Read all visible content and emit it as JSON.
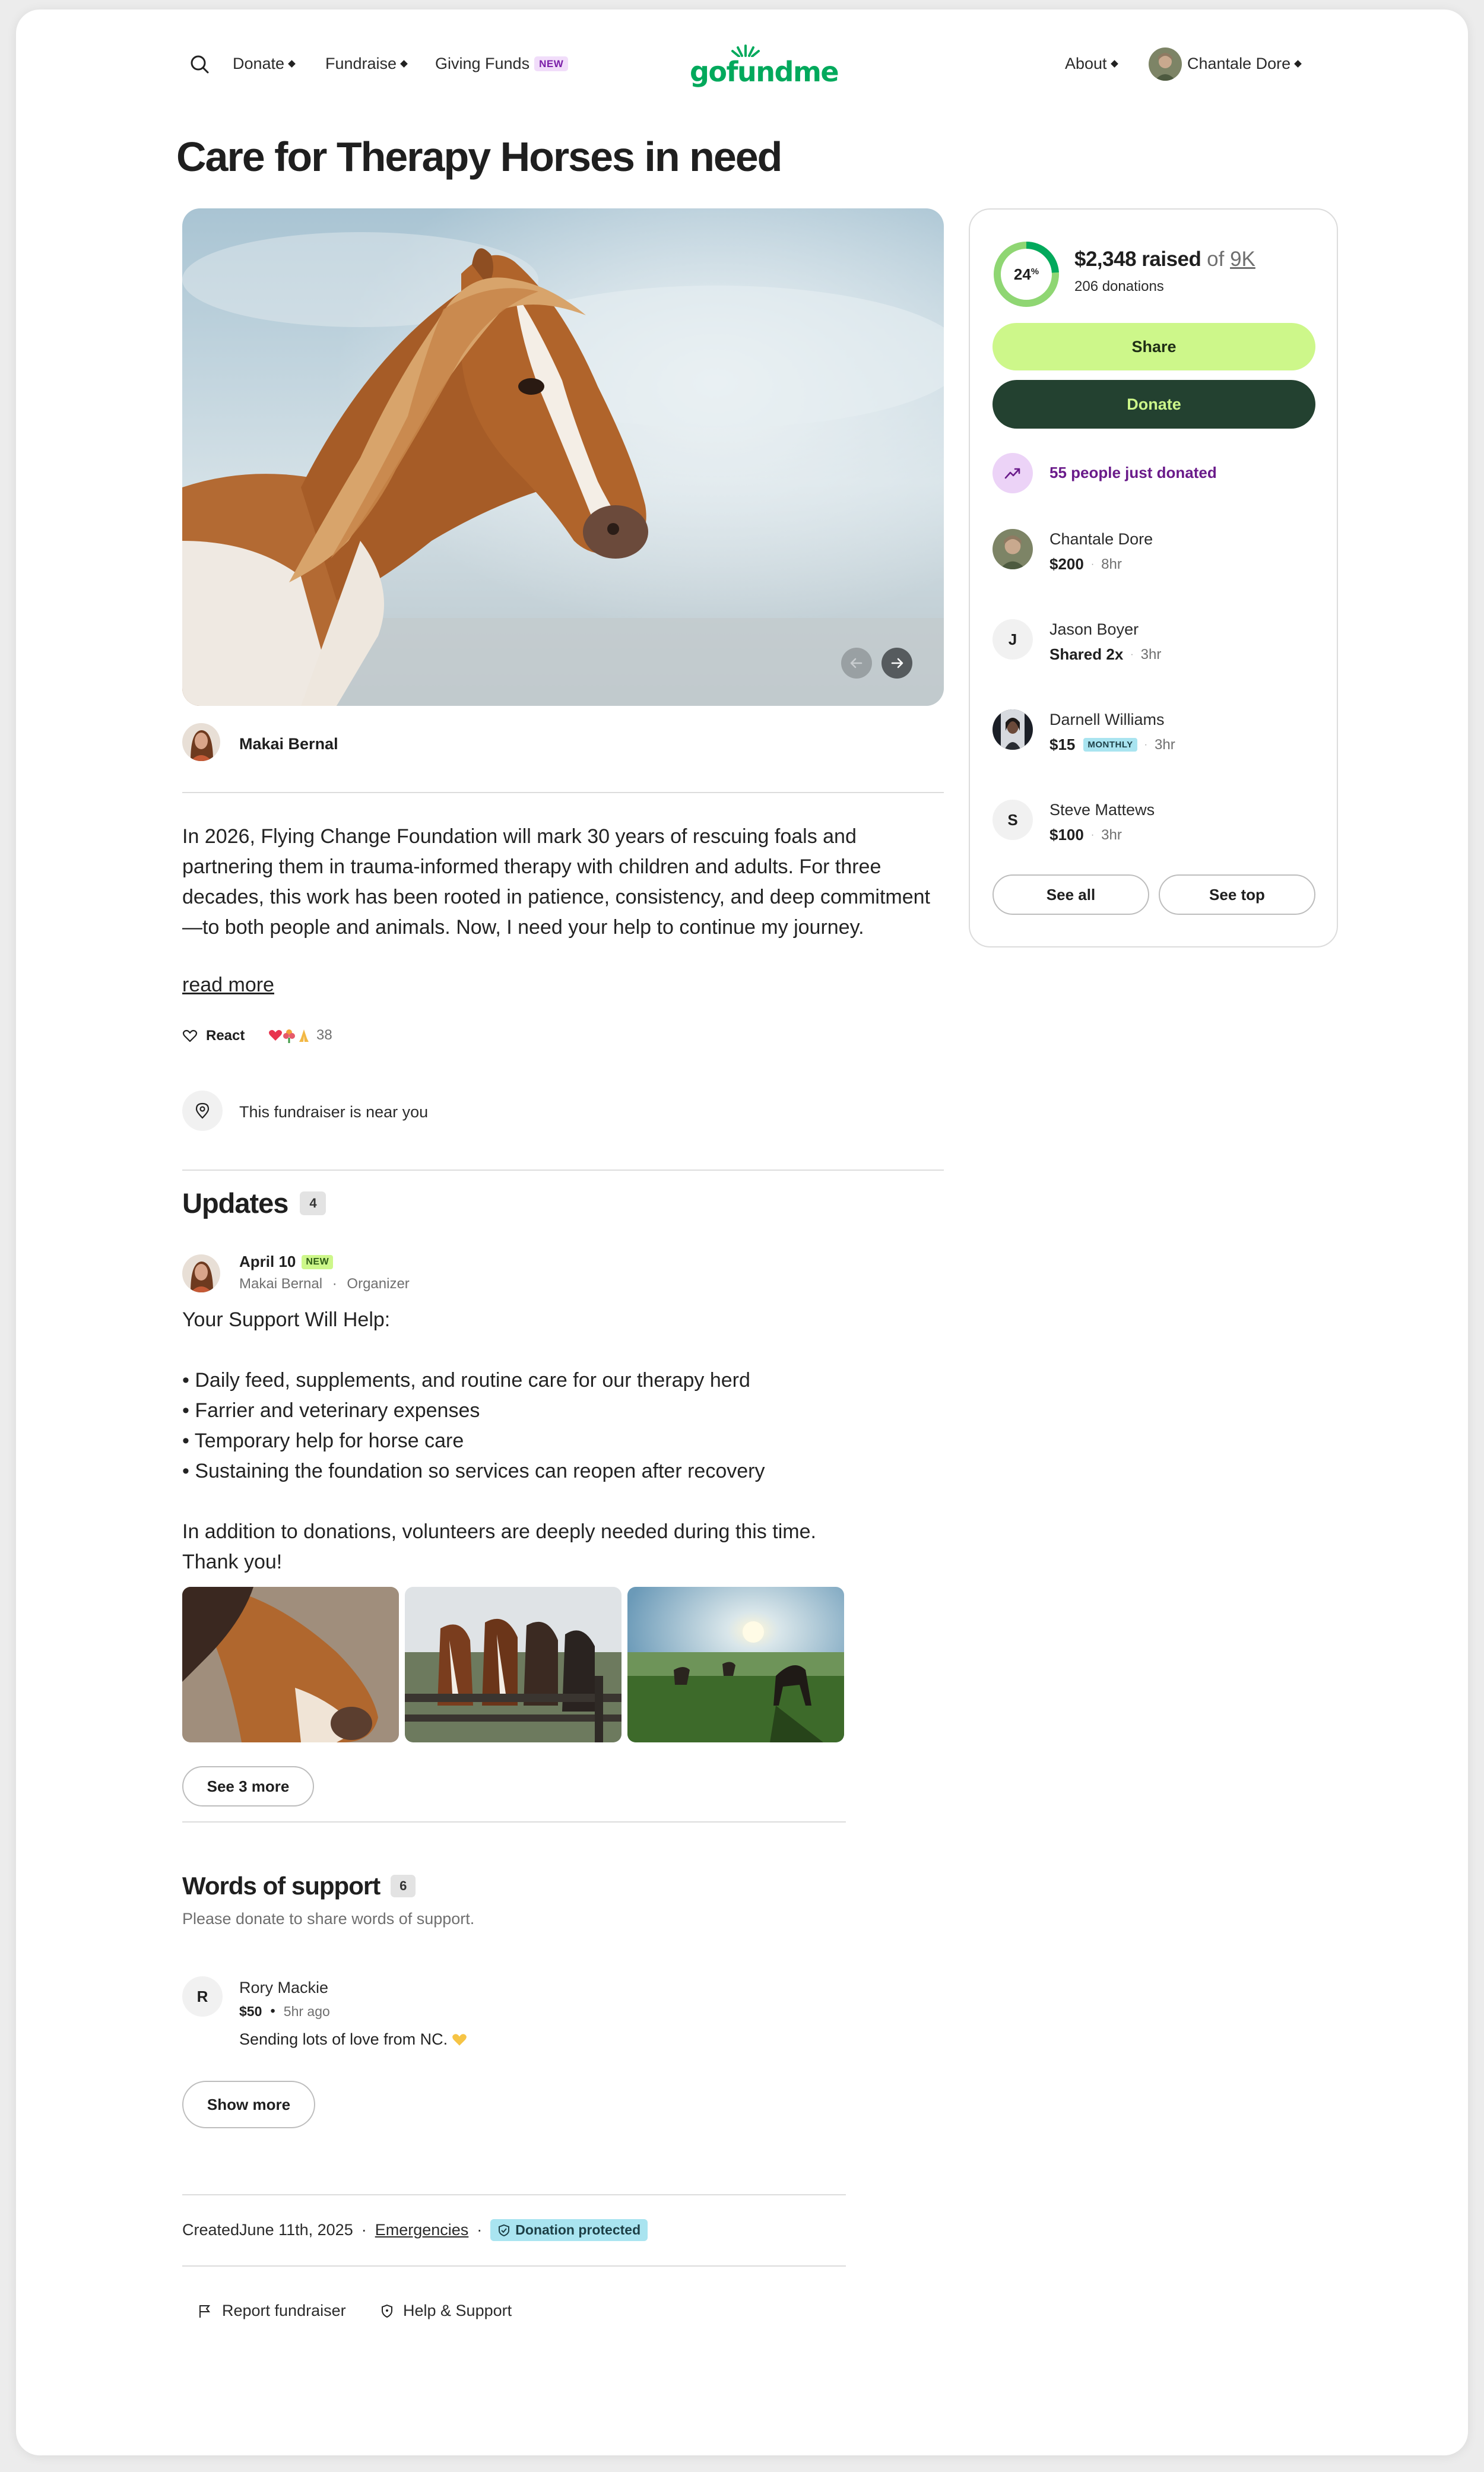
{
  "header": {
    "nav": {
      "donate": "Donate",
      "fundraise": "Fundraise",
      "giving_funds": "Giving Funds",
      "new_badge": "NEW"
    },
    "logo": "gofundme",
    "about": "About",
    "user_name": "Chantale Dore"
  },
  "campaign": {
    "title": "Care for Therapy Horses in need",
    "organizer": "Makai Bernal",
    "story": "In 2026, Flying Change Foundation will mark 30 years of rescuing foals and partnering them in trauma-informed therapy with children and adults. For three decades, this work has been rooted in patience, consistency, and deep commitment—to both people and animals. Now, I need your help to continue my journey.",
    "read_more": "read more",
    "react_label": "React",
    "reactions_count": "38",
    "near_you": "This fundraiser is near you"
  },
  "progress": {
    "percent": 24,
    "percent_text": "24",
    "percent_sign": "%",
    "raised": "$2,348 raised",
    "of": "of",
    "goal": "9K",
    "donations": "206 donations",
    "share": "Share",
    "donate": "Donate",
    "just_donated": "55 people just donated"
  },
  "donors": [
    {
      "name": "Chantale Dore",
      "amount": "$200",
      "time": "8hr"
    },
    {
      "name": "Jason Boyer",
      "initial": "J",
      "amount": "Shared 2x",
      "time": "3hr"
    },
    {
      "name": "Darnell Williams",
      "amount": "$15",
      "badge": "MONTHLY",
      "time": "3hr"
    },
    {
      "name": "Steve Mattews",
      "initial": "S",
      "amount": "$100",
      "time": "3hr"
    }
  ],
  "sidebar_buttons": {
    "see_all": "See all",
    "see_top": "See top"
  },
  "updates": {
    "title": "Updates",
    "count": "4",
    "date": "April 10",
    "new_badge": "NEW",
    "author": "Makai Bernal",
    "role": "Organizer",
    "text": "Your Support Will Help:\n\n• Daily feed, supplements, and routine care for our therapy herd\n• Farrier and veterinary expenses\n• Temporary help for horse care\n• Sustaining the foundation so services can reopen after recovery\n\nIn addition to donations, volunteers are deeply needed during this time. Thank you!",
    "see_more": "See 3 more"
  },
  "support": {
    "title": "Words of support",
    "count": "6",
    "subtitle": "Please donate to share words of support.",
    "comment": {
      "initial": "R",
      "name": "Rory Mackie",
      "amount": "$50",
      "time": "5hr ago",
      "text": "Sending lots of love from NC."
    },
    "show_more": "Show more"
  },
  "footer": {
    "created": "CreatedJune 11th, 2025",
    "category": "Emergencies",
    "protected": "Donation protected",
    "report": "Report fundraiser",
    "help": "Help & Support"
  },
  "colors": {
    "brand": "#02a95c",
    "share_btn": "#cdf78a",
    "donate_btn": "#234130",
    "donate_text": "#cdf78a",
    "purple": "#6a1b8a",
    "monthly": "#a9e4f0",
    "protected": "#a9e4f0"
  }
}
